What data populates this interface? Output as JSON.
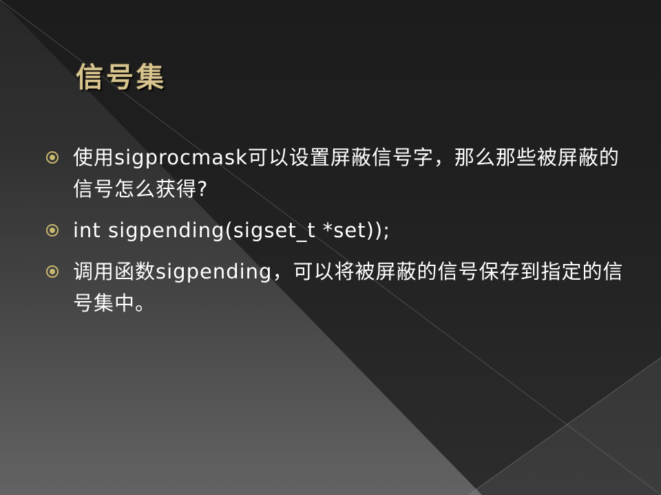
{
  "slide": {
    "title": "信号集",
    "bullets": [
      {
        "text": "使用sigprocmask可以设置屏蔽信号字，那么那些被屏蔽的信号怎么获得?"
      },
      {
        "text": "int sigpending(sigset_t *set));"
      },
      {
        "text": "调用函数sigpending，可以将被屏蔽的信号保存到指定的信号集中。"
      }
    ]
  },
  "colors": {
    "title": "#d7c48e",
    "text": "#ffffff",
    "bullet_icon": "#c9b870",
    "background_top": "#1a1a1a",
    "background_bottom": "#5a5a5a"
  },
  "icons": {
    "bullet": "circled-dot-icon"
  }
}
